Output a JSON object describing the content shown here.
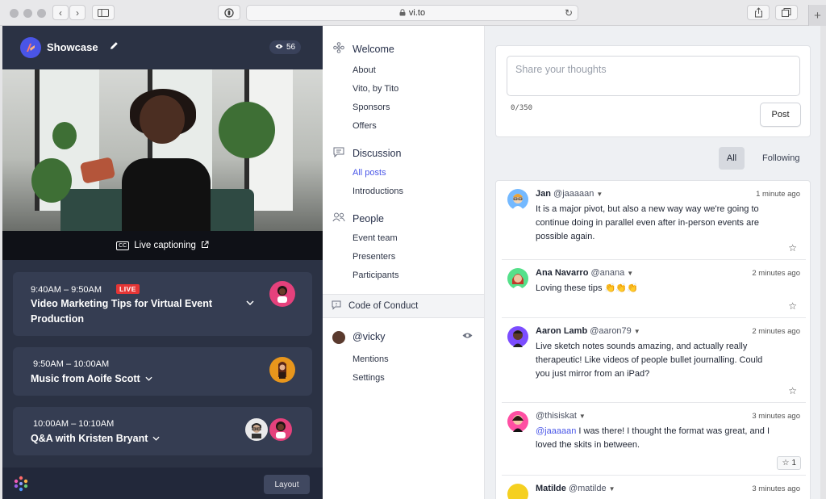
{
  "browser": {
    "url": "vi.to",
    "lock_icon": "lock-icon",
    "back_glyph": "‹",
    "forward_glyph": "›"
  },
  "left": {
    "brand": "Showcase",
    "viewer_count": "56",
    "captioning_label": "Live captioning",
    "cc_badge": "CC",
    "sessions": [
      {
        "time": "9:40AM – 9:50AM",
        "live": "LIVE",
        "title_line1": "Video Marketing Tips for Virtual Event",
        "title_line2": "Production"
      },
      {
        "time": "9:50AM – 10:00AM",
        "title": "Music from Aoife Scott"
      },
      {
        "time": "10:00AM – 10:10AM",
        "title": "Q&A with Kristen Bryant"
      }
    ],
    "layout_button": "Layout"
  },
  "nav": {
    "welcome": {
      "label": "Welcome",
      "items": [
        "About",
        "Vito, by Tito",
        "Sponsors",
        "Offers"
      ]
    },
    "discussion": {
      "label": "Discussion",
      "items": [
        "All posts",
        "Introductions"
      ]
    },
    "people": {
      "label": "People",
      "items": [
        "Event team",
        "Presenters",
        "Participants"
      ]
    },
    "code_of_conduct": "Code of Conduct",
    "user": {
      "handle": "@vicky",
      "items": [
        "Mentions",
        "Settings"
      ]
    }
  },
  "feed": {
    "compose_placeholder": "Share your thoughts",
    "counter": "0/350",
    "post_button": "Post",
    "filter_all": "All",
    "filter_following": "Following",
    "posts": [
      {
        "name": "Jan",
        "handle": "@jaaaaan",
        "time": "1 minute ago",
        "body": "It is a major pivot, but also a new way way we're going to continue doing in parallel even after in-person events are possible again."
      },
      {
        "name": "Ana Navarro",
        "handle": "@anana",
        "time": "2 minutes ago",
        "body": "Loving these tips 👏👏👏"
      },
      {
        "name": "Aaron Lamb",
        "handle": "@aaron79",
        "time": "2 minutes ago",
        "body": "Live sketch notes sounds amazing, and actually really therapeutic! Like videos of people bullet journalling. Could you just mirror from an iPad?"
      },
      {
        "name": "",
        "handle": "@thisiskat",
        "time": "3 minutes ago",
        "mention": "@jaaaaan",
        "body": " I was there! I thought the format was great, and I loved the skits in between.",
        "stars": "1"
      },
      {
        "name": "Matilde",
        "handle": "@matilde",
        "time": "3 minutes ago"
      }
    ]
  },
  "colors": {
    "dark_panel": "#2b3244",
    "session_card": "#353d52",
    "live_red": "#e53535",
    "accent": "#4a57e8"
  }
}
